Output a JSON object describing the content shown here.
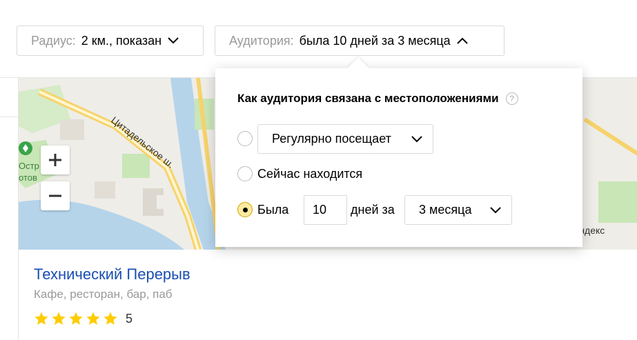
{
  "filters": {
    "radius": {
      "label": "Радиус:",
      "value": "2 км., показан"
    },
    "audience": {
      "label": "Аудитория:",
      "value": "была 10 дней за 3 месяца"
    }
  },
  "map": {
    "street": "Цитадельское ш.",
    "poi_text": "Остр\nотов",
    "attribution": "© Яндекс"
  },
  "place": {
    "name": "Технический Перерыв",
    "category": "Кафе, ресторан, бар, паб",
    "rating": 5,
    "rating_text": "5"
  },
  "popup": {
    "title": "Как аудитория связана с местоположениями",
    "help": "?",
    "options": {
      "regular": {
        "select_value": "Регулярно посещает",
        "checked": false
      },
      "now": {
        "label": "Сейчас находится",
        "checked": false
      },
      "was": {
        "label_before": "Была",
        "days": "10",
        "label_mid": "дней за",
        "period": "3 месяца",
        "checked": true
      }
    }
  },
  "colors": {
    "link": "#1a4eb1",
    "star": "#ffcc00",
    "radio_checked": "#ffeba0",
    "water": "#b5d4ea",
    "park": "#c9e6b7",
    "road": "#f6d36b"
  }
}
